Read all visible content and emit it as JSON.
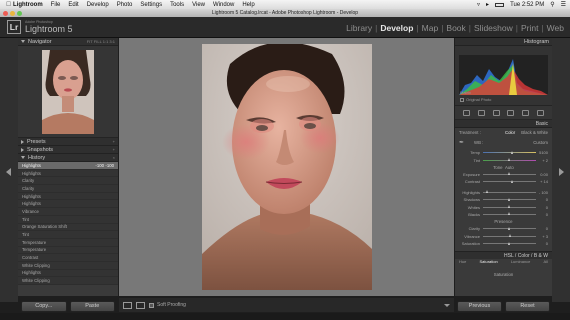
{
  "menubar": {
    "app": "Lightroom",
    "items": [
      "File",
      "Edit",
      "Develop",
      "Photo",
      "Settings",
      "Tools",
      "View",
      "Window",
      "Help"
    ],
    "clock": "Tue 2:52 PM"
  },
  "window": {
    "title": "Lightroom 5 Catalog.lrcat - Adobe Photoshop Lightroom - Develop"
  },
  "identity": {
    "logo": "Lr",
    "small": "Adobe Photoshop",
    "product": "Lightroom 5"
  },
  "modules": [
    "Library",
    "Develop",
    "Map",
    "Book",
    "Slideshow",
    "Print",
    "Web"
  ],
  "active_module": "Develop",
  "left": {
    "navigator": {
      "title": "Navigator",
      "options": "FIT  FILL  1:1  3:1"
    },
    "presets": "Presets",
    "snapshots": "Snapshots",
    "history_title": "History",
    "history": [
      {
        "label": "Highlights",
        "v1": "-100",
        "v2": "-100"
      },
      {
        "label": "Highlights",
        "v1": "",
        "v2": ""
      },
      {
        "label": "Clarity",
        "v1": "",
        "v2": ""
      },
      {
        "label": "Clarity",
        "v1": "",
        "v2": ""
      },
      {
        "label": "Highlights",
        "v1": "",
        "v2": ""
      },
      {
        "label": "Highlights",
        "v1": "",
        "v2": ""
      },
      {
        "label": "Vibrance",
        "v1": "",
        "v2": ""
      },
      {
        "label": "Tint",
        "v1": "",
        "v2": ""
      },
      {
        "label": "Orange Saturation Shift",
        "v1": "",
        "v2": ""
      },
      {
        "label": "Tint",
        "v1": "",
        "v2": ""
      },
      {
        "label": "Temperature",
        "v1": "",
        "v2": ""
      },
      {
        "label": "Temperature",
        "v1": "",
        "v2": ""
      },
      {
        "label": "Contrast",
        "v1": "",
        "v2": ""
      },
      {
        "label": "White Clipping",
        "v1": "",
        "v2": ""
      },
      {
        "label": "Highlights",
        "v1": "",
        "v2": ""
      },
      {
        "label": "White Clipping",
        "v1": "",
        "v2": ""
      }
    ],
    "copy_label": "Copy...",
    "paste_label": "Paste"
  },
  "toolbar": {
    "soft_proofing": "Soft Proofing"
  },
  "right": {
    "histogram_title": "Histogram",
    "histogram_info": "Matrix",
    "original_photo": "Original Photo",
    "basic_title": "Basic",
    "treatment_label": "Treatment :",
    "treatment_color": "Color",
    "treatment_bw": "Black & White",
    "wb_label": "WB :",
    "wb_value": "Custom",
    "sliders_wb": [
      {
        "label": "Temp",
        "value": "5100",
        "pos": 0.55
      },
      {
        "label": "Tint",
        "value": "+ 2",
        "pos": 0.5
      }
    ],
    "tone_label": "Tone",
    "tone_auto": "Auto",
    "sliders_tone": [
      {
        "label": "Exposure",
        "value": "0.00",
        "pos": 0.5
      },
      {
        "label": "Contrast",
        "value": "+ 14",
        "pos": 0.55
      }
    ],
    "sliders_tone2": [
      {
        "label": "Highlights",
        "value": "- 100",
        "pos": 0.08
      },
      {
        "label": "Shadows",
        "value": "0",
        "pos": 0.5
      },
      {
        "label": "Whites",
        "value": "0",
        "pos": 0.5
      },
      {
        "label": "Blacks",
        "value": "0",
        "pos": 0.5
      }
    ],
    "presence_label": "Presence",
    "sliders_presence": [
      {
        "label": "Clarity",
        "value": "0",
        "pos": 0.5
      },
      {
        "label": "Vibrance",
        "value": "+ 3",
        "pos": 0.52
      },
      {
        "label": "Saturation",
        "value": "0",
        "pos": 0.5
      }
    ],
    "hsl_title": "HSL / Color / B & W",
    "hsl_tabs": [
      "Hue",
      "Saturation",
      "Luminance",
      "All"
    ],
    "hsl_active": "Saturation",
    "saturation_label": "Saturation",
    "previous_label": "Previous",
    "reset_label": "Reset"
  },
  "colors": {
    "panel": "#3a3a3a",
    "background": "#787878",
    "active_text": "#e6e6e6"
  }
}
